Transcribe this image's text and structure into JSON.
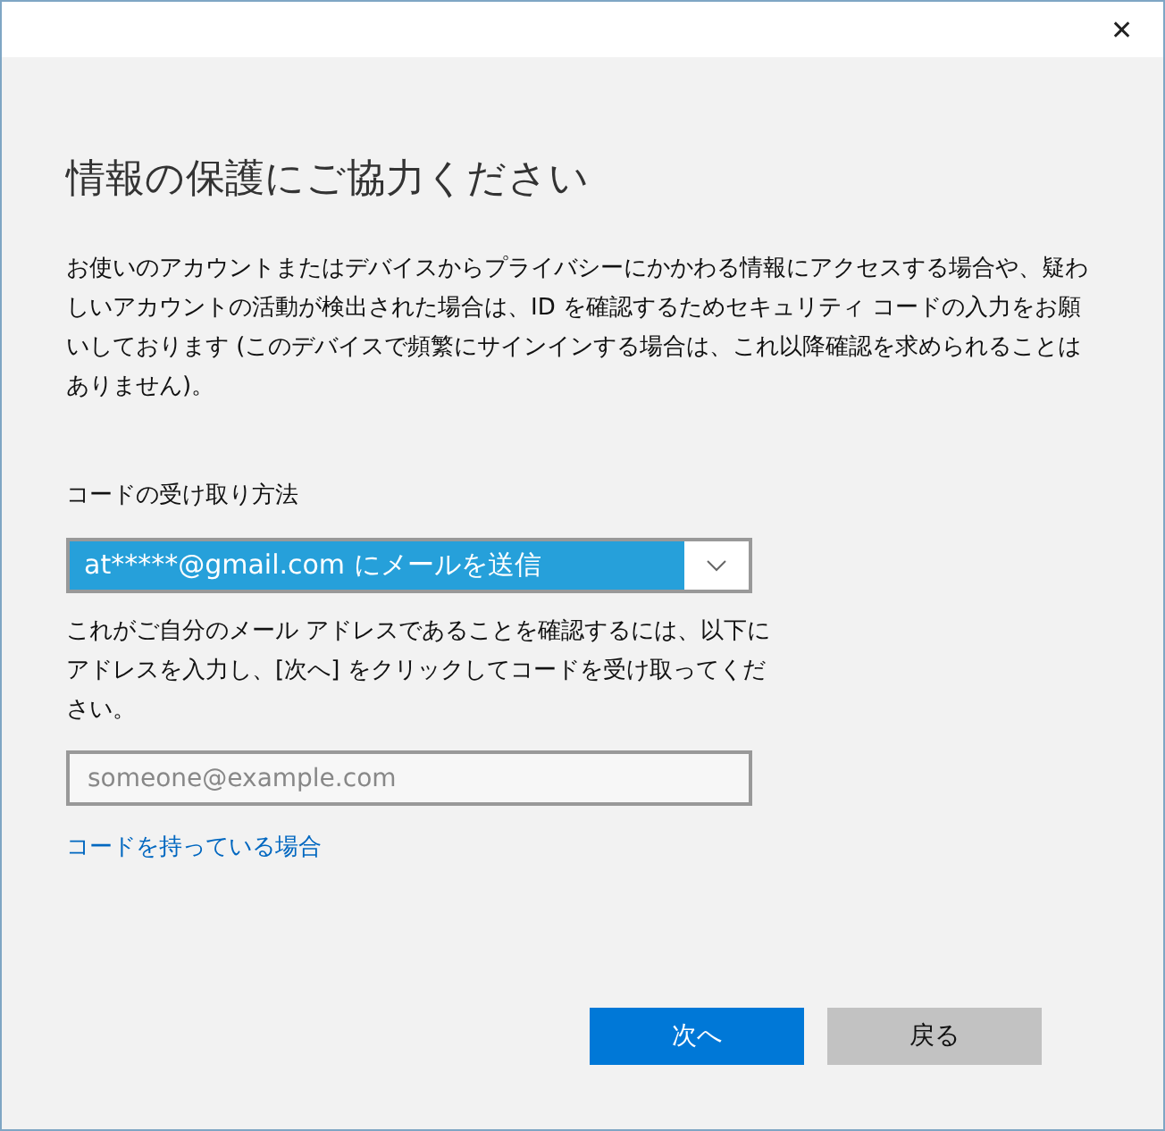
{
  "window": {
    "close": "✕"
  },
  "heading": "情報の保護にご協力ください",
  "description": "お使いのアカウントまたはデバイスからプライバシーにかかわる情報にアクセスする場合や、疑わしいアカウントの活動が検出された場合は、ID を確認するためセキュリティ コードの入力をお願いしております (このデバイスで頻繁にサインインする場合は、これ以降確認を求められることはありません)。",
  "method": {
    "label": "コードの受け取り方法",
    "value": "at*****@gmail.com にメールを送信"
  },
  "instruction": "これがご自分のメール アドレスであることを確認するには、以下にアドレスを入力し、[次へ] をクリックしてコードを受け取ってください。",
  "email_field": {
    "placeholder": "someone@example.com"
  },
  "have_code_link": "コードを持っている場合",
  "buttons": [
    {
      "label": "次へ",
      "kind": "primary"
    },
    {
      "label": "戻る",
      "kind": "secondary"
    }
  ]
}
